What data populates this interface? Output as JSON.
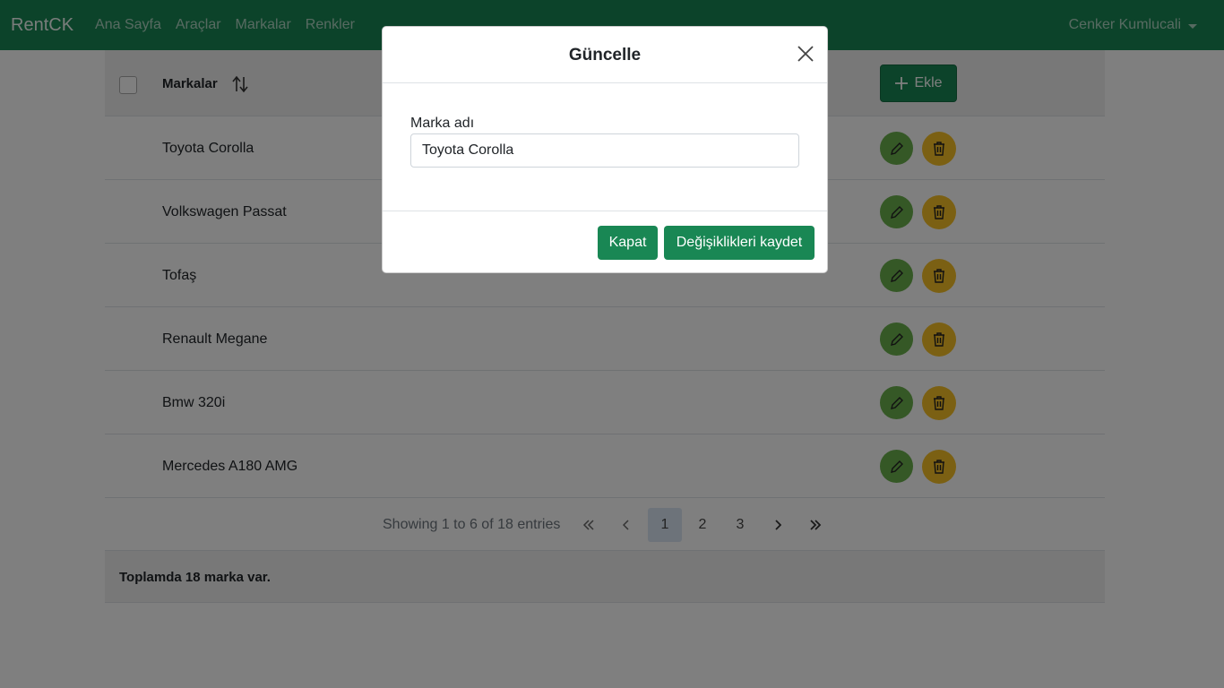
{
  "navbar": {
    "brand": "RentCK",
    "links": [
      "Ana Sayfa",
      "Araçlar",
      "Markalar",
      "Renkler"
    ],
    "user": "Cenker Kumlucali"
  },
  "table": {
    "header_label": "Markalar",
    "add_label": "Ekle",
    "rows": [
      "Toyota Corolla",
      "Volkswagen Passat",
      "Tofaş",
      "Renault Megane",
      "Bmw 320i",
      "Mercedes A180 AMG"
    ],
    "pager": {
      "info": "Showing 1 to 6 of 18 entries",
      "first": "«",
      "prev": "‹",
      "pages": [
        "1",
        "2",
        "3"
      ],
      "next": "›",
      "last": "»",
      "active_page": "1"
    },
    "footer": "Toplamda 18 marka var."
  },
  "modal": {
    "title": "Güncelle",
    "field_label": "Marka adı",
    "field_value": "Toyota Corolla",
    "close_label": "Kapat",
    "save_label": "Değişiklikleri kaydet"
  },
  "colors": {
    "primary": "#198754",
    "edit": "#6ab04c",
    "delete": "#f6c026"
  }
}
